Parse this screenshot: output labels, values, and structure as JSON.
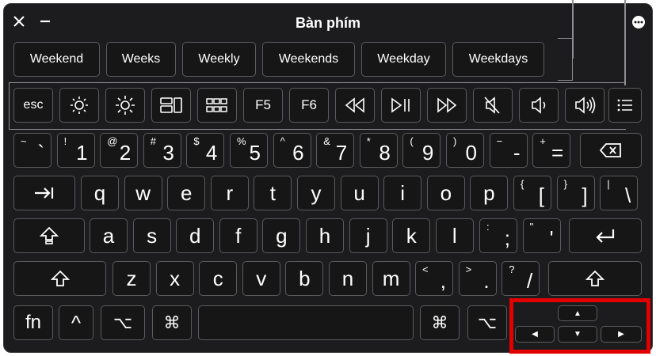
{
  "window": {
    "title": "Bàn phím",
    "close_symbol": "✕",
    "minimize_symbol": "—",
    "more_icon": "ellipsis-circle-icon"
  },
  "suggestions": [
    "Weekend",
    "Weeks",
    "Weekly",
    "Weekends",
    "Weekday",
    "Weekdays"
  ],
  "function_row": {
    "esc": "esc",
    "f5": "F5",
    "f6": "F6"
  },
  "number_row": [
    {
      "top": "~",
      "main": "`"
    },
    {
      "top": "!",
      "main": "1"
    },
    {
      "top": "@",
      "main": "2"
    },
    {
      "top": "#",
      "main": "3"
    },
    {
      "top": "$",
      "main": "4"
    },
    {
      "top": "%",
      "main": "5"
    },
    {
      "top": "^",
      "main": "6"
    },
    {
      "top": "&",
      "main": "7"
    },
    {
      "top": "*",
      "main": "8"
    },
    {
      "top": "(",
      "main": "9"
    },
    {
      "top": ")",
      "main": "0"
    },
    {
      "top": "−",
      "main": "-"
    },
    {
      "top": "+",
      "main": "="
    }
  ],
  "qwerty_row": [
    "q",
    "w",
    "e",
    "r",
    "t",
    "y",
    "u",
    "i",
    "o",
    "p"
  ],
  "qwerty_brackets": [
    {
      "top": "{",
      "main": "["
    },
    {
      "top": "}",
      "main": "]"
    },
    {
      "top": "|",
      "main": "\\"
    }
  ],
  "home_row": [
    "a",
    "s",
    "d",
    "f",
    "g",
    "h",
    "j",
    "k",
    "l"
  ],
  "home_extra": [
    {
      "top": ":",
      "main": ";"
    },
    {
      "top": "\"",
      "main": "'"
    }
  ],
  "bottom_letters": [
    "z",
    "x",
    "c",
    "v",
    "b",
    "n",
    "m"
  ],
  "bottom_extra": [
    {
      "top": "<",
      "main": ","
    },
    {
      "top": ">",
      "main": "."
    },
    {
      "top": "?",
      "main": "/"
    }
  ],
  "modifiers": {
    "fn": "fn",
    "ctrl": "^",
    "option": "⌥",
    "command": "⌘"
  },
  "arrows": {
    "up": "▲",
    "left": "◀",
    "down": "▼",
    "right": "▶"
  }
}
